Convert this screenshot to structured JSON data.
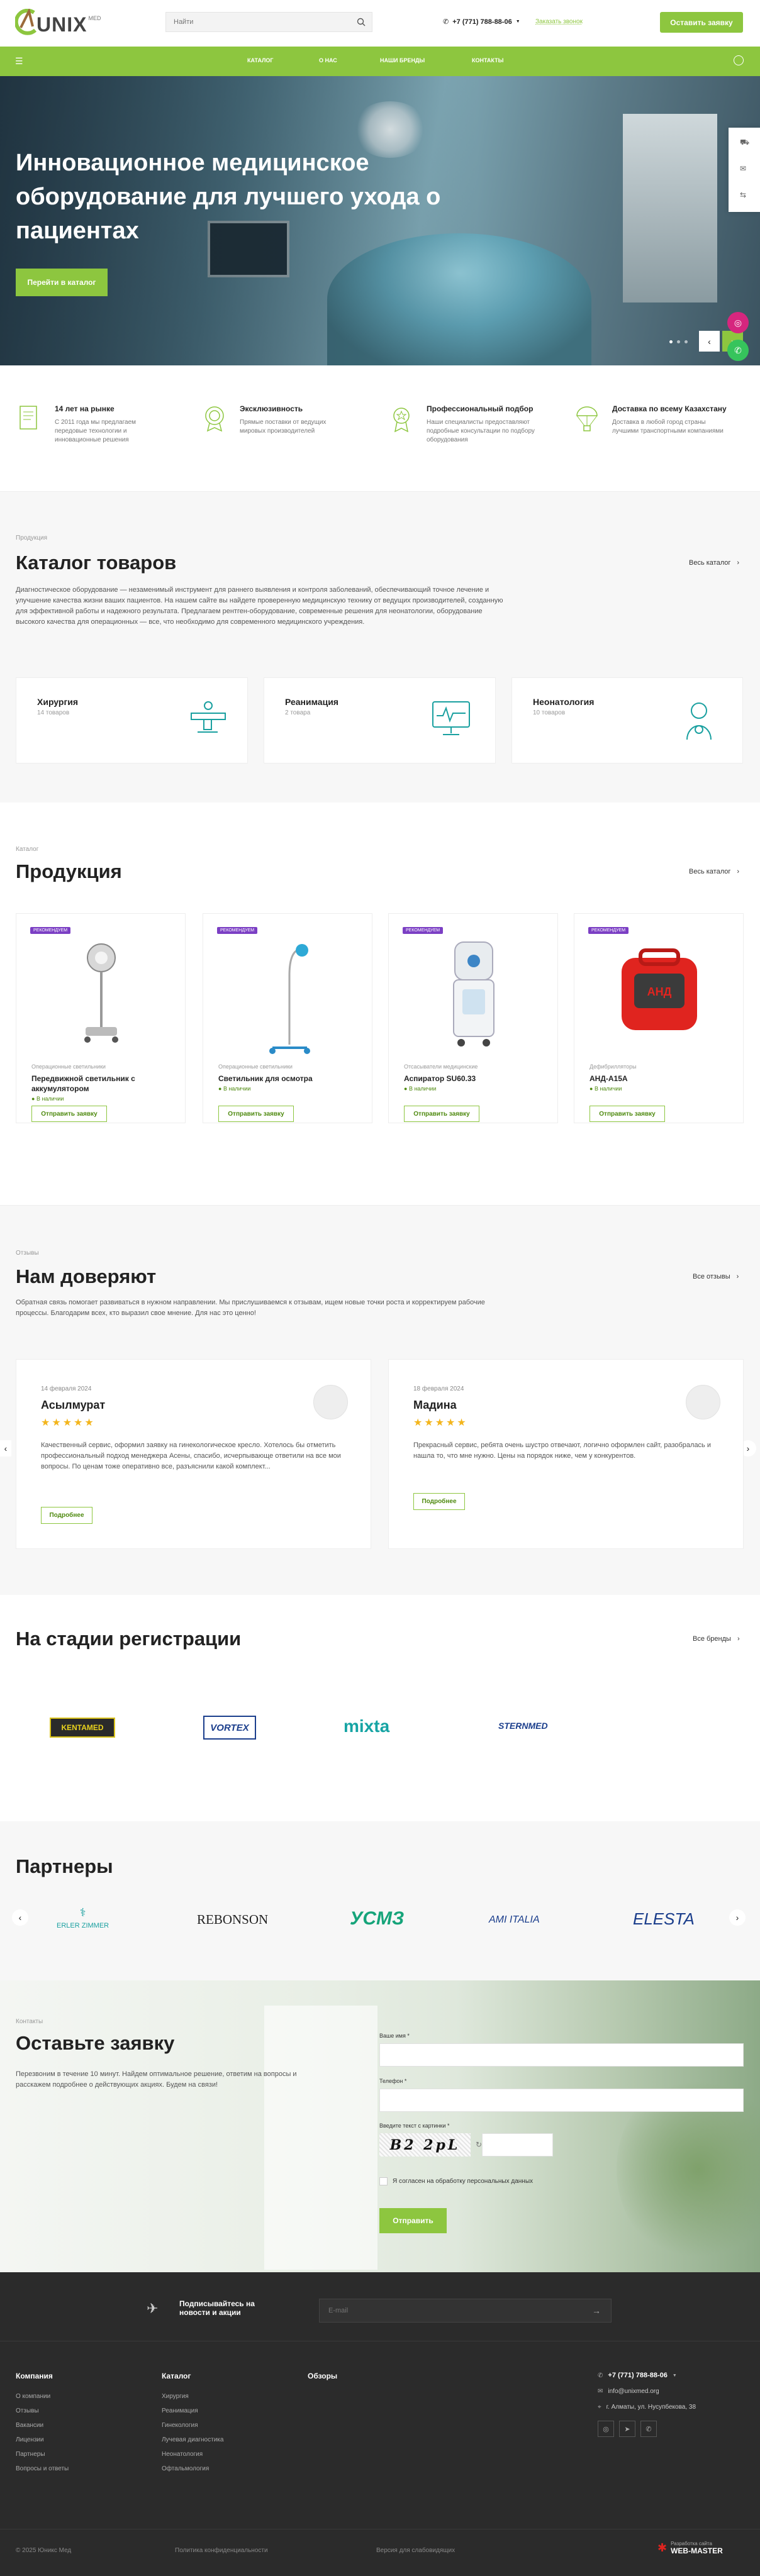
{
  "brand": {
    "logo_text": "UNIX",
    "logo_sub": "MED",
    "accent": "#8dc63f",
    "purple": "#7b3fc4"
  },
  "header": {
    "search_placeholder": "Найти",
    "phone": "+7 (771) 788-88-06",
    "callback": "Заказать звонок",
    "cta": "Оставить заявку"
  },
  "nav": {
    "items": [
      "КАТАЛОГ",
      "О НАС",
      "НАШИ БРЕНДЫ",
      "КОНТАКТЫ"
    ]
  },
  "hero": {
    "title": "Инновационное медицинское оборудование для лучшего ухода о пациентах",
    "button": "Перейти в каталог"
  },
  "features": [
    {
      "title": "14 лет на рынке",
      "text": "С 2011 года мы предлагаем передовые технологии и инновационные решения",
      "icon": "document-icon"
    },
    {
      "title": "Эксклюзивность",
      "text": "Прямые поставки от ведущих мировых производителей",
      "icon": "medal-icon"
    },
    {
      "title": "Профессиональный подбор",
      "text": "Наши специалисты предоставляют подробные консультации по подбору оборудования",
      "icon": "award-icon"
    },
    {
      "title": "Доставка по всему Казахстану",
      "text": "Доставка в любой город страны лучшими транспортными компаниями",
      "icon": "parachute-icon"
    }
  ],
  "catalog": {
    "label": "Продукция",
    "title": "Каталог товаров",
    "more": "Весь каталог",
    "text": "Диагностическое оборудование — незаменимый инструмент для раннего выявления и контроля заболеваний, обеспечивающий точное лечение и улучшение качества жизни ваших пациентов. На нашем сайте вы найдете проверенную медицинскую технику от ведущих производителей, созданную для эффективной работы и надежного результата. Предлагаем рентген-оборудование, современные решения для неонатологии, оборудование высокого качества для операционных — все, что необходимо для современного медицинского учреждения.",
    "cats": [
      {
        "name": "Хирургия",
        "count": "14 товаров"
      },
      {
        "name": "Реанимация",
        "count": "2 товара"
      },
      {
        "name": "Неонатология",
        "count": "10 товаров"
      }
    ]
  },
  "products": {
    "label": "Каталог",
    "title": "Продукция",
    "more": "Весь каталог",
    "badge": "РЕКОМЕНДУЕМ",
    "stock": "В наличии",
    "button": "Отправить заявку",
    "items": [
      {
        "cat": "Операционные светильники",
        "name": "Передвижной светильник с аккумулятором"
      },
      {
        "cat": "Операционные светильники",
        "name": "Светильник для осмотра"
      },
      {
        "cat": "Отсасыватели медицинские",
        "name": "Аспиратор SU60.33"
      },
      {
        "cat": "Дефибрилляторы",
        "name": "АНД-A15A"
      }
    ]
  },
  "reviews": {
    "label": "Отзывы",
    "title": "Нам доверяют",
    "more": "Все отзывы",
    "text": "Обратная связь помогает развиваться в нужном направлении. Мы прислушиваемся к отзывам, ищем новые точки роста и корректируем рабочие процессы. Благодарим всех, кто выразил свое мнение. Для нас это ценно!",
    "button": "Подробнее",
    "items": [
      {
        "date": "14 февраля 2024",
        "name": "Асылмурат",
        "text": "Качественный сервис, оформил заявку на гинекологическое кресло. Хотелось бы отметить профессиональный подход менеджера Асены, спасибо, исчерпывающе ответили на все мои вопросы. По ценам тоже оперативно все, разъяснили какой комплект..."
      },
      {
        "date": "18 февраля 2024",
        "name": "Мадина",
        "text": "Прекрасный сервис, ребята очень шустро отвечают, логично оформлен сайт, разобралась и нашла то, что мне нужно. Цены на порядок ниже, чем у конкурентов."
      }
    ]
  },
  "brands": {
    "title": "На стадии регистрации",
    "more": "Все бренды",
    "items": [
      "KENTAMED",
      "VORTEX",
      "mixta",
      "STERNMED"
    ]
  },
  "partners": {
    "title": "Партнеры",
    "items": [
      "ERLER ZIMMER",
      "REBONSON",
      "УСМЗ",
      "AMI ITALIA",
      "ELESTA"
    ]
  },
  "form": {
    "label": "Контакты",
    "title": "Оставьте заявку",
    "text": "Перезвоним в течение 10 минут. Найдем оптимальное решение, ответим на вопросы и расскажем подробнее о действующих акциях. Будем на связи!",
    "name_label": "Ваше имя *",
    "phone_label": "Телефон *",
    "captcha_label": "Введите текст с картинки *",
    "captcha": "B2 2pL",
    "consent": "Я согласен на обработку персональных данных",
    "submit": "Отправить"
  },
  "footer": {
    "subscribe": "Подписывайтесь на новости и акции",
    "email_placeholder": "E-mail",
    "col1": {
      "title": "Компания",
      "links": [
        "О компании",
        "Отзывы",
        "Вакансии",
        "Лицензии",
        "Партнеры",
        "Вопросы и ответы"
      ]
    },
    "col2": {
      "title": "Каталог",
      "links": [
        "Хирургия",
        "Реанимация",
        "Гинекология",
        "Лучевая диагностика",
        "Неонатология",
        "Офтальмология"
      ]
    },
    "col3": {
      "title": "Обзоры"
    },
    "phone": "+7 (771) 788-88-06",
    "email": "info@unixmed.org",
    "address": "г. Алматы, ул. Нусупбекова, 38",
    "copyright": "© 2025 Юникс Мед",
    "privacy": "Политика конфиденциальности",
    "visually": "Версия для слабовидящих",
    "dev_top": "Разработка сайта",
    "dev": "WEB-MASTER"
  }
}
